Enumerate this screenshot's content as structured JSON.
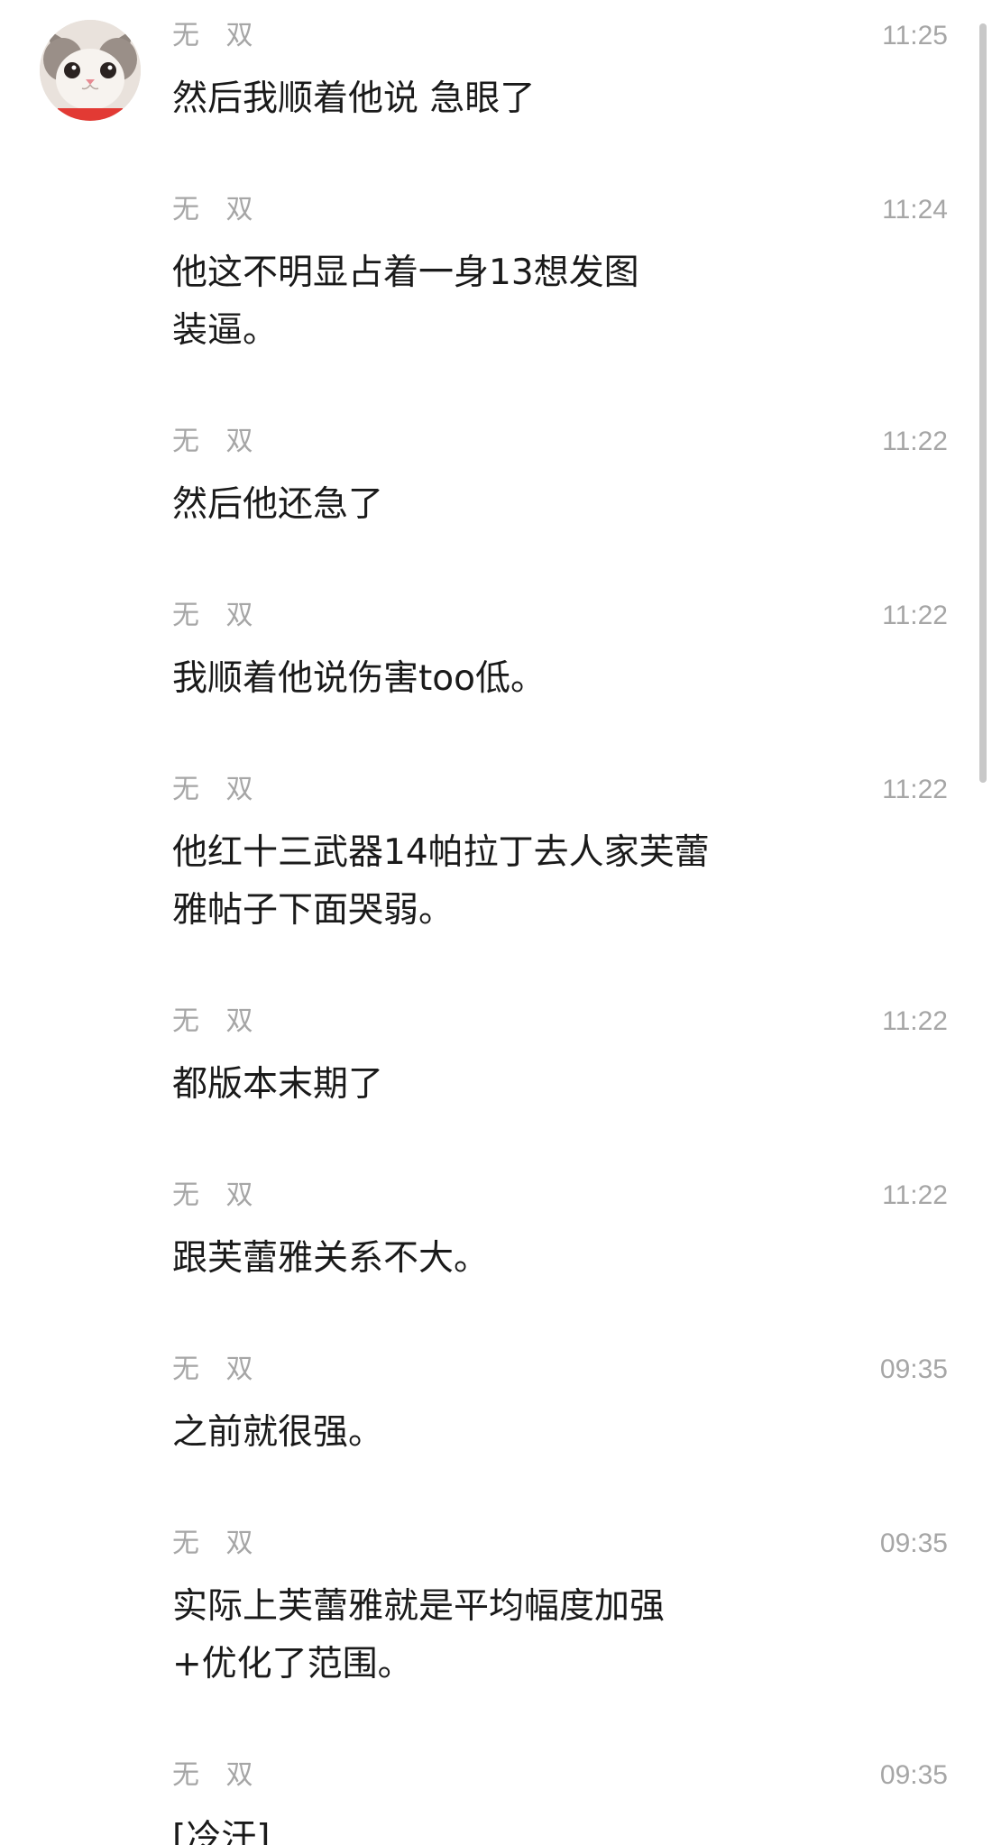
{
  "chat": {
    "avatar_icon": "cat-avatar-icon",
    "colors": {
      "name": "#a6a6a6",
      "time": "#a6a6a6",
      "text": "#1a1a1a",
      "scrollbar": "#c8c8c8"
    },
    "messages": [
      {
        "sender": "无 双",
        "time": "11:25",
        "text": "然后我顺着他说 急眼了"
      },
      {
        "sender": "无 双",
        "time": "11:24",
        "text": "他这不明显占着一身13想发图\n装逼。"
      },
      {
        "sender": "无 双",
        "time": "11:22",
        "text": "然后他还急了"
      },
      {
        "sender": "无 双",
        "time": "11:22",
        "text": "我顺着他说伤害too低。"
      },
      {
        "sender": "无 双",
        "time": "11:22",
        "text": "他红十三武器14帕拉丁去人家芙蕾\n雅帖子下面哭弱。"
      },
      {
        "sender": "无 双",
        "time": "11:22",
        "text": "都版本末期了"
      },
      {
        "sender": "无 双",
        "time": "11:22",
        "text": "跟芙蕾雅关系不大。"
      },
      {
        "sender": "无 双",
        "time": "09:35",
        "text": "之前就很强。"
      },
      {
        "sender": "无 双",
        "time": "09:35",
        "text": "实际上芙蕾雅就是平均幅度加强\n+优化了范围。"
      },
      {
        "sender": "无 双",
        "time": "09:35",
        "text": "[冷汗]"
      }
    ]
  }
}
